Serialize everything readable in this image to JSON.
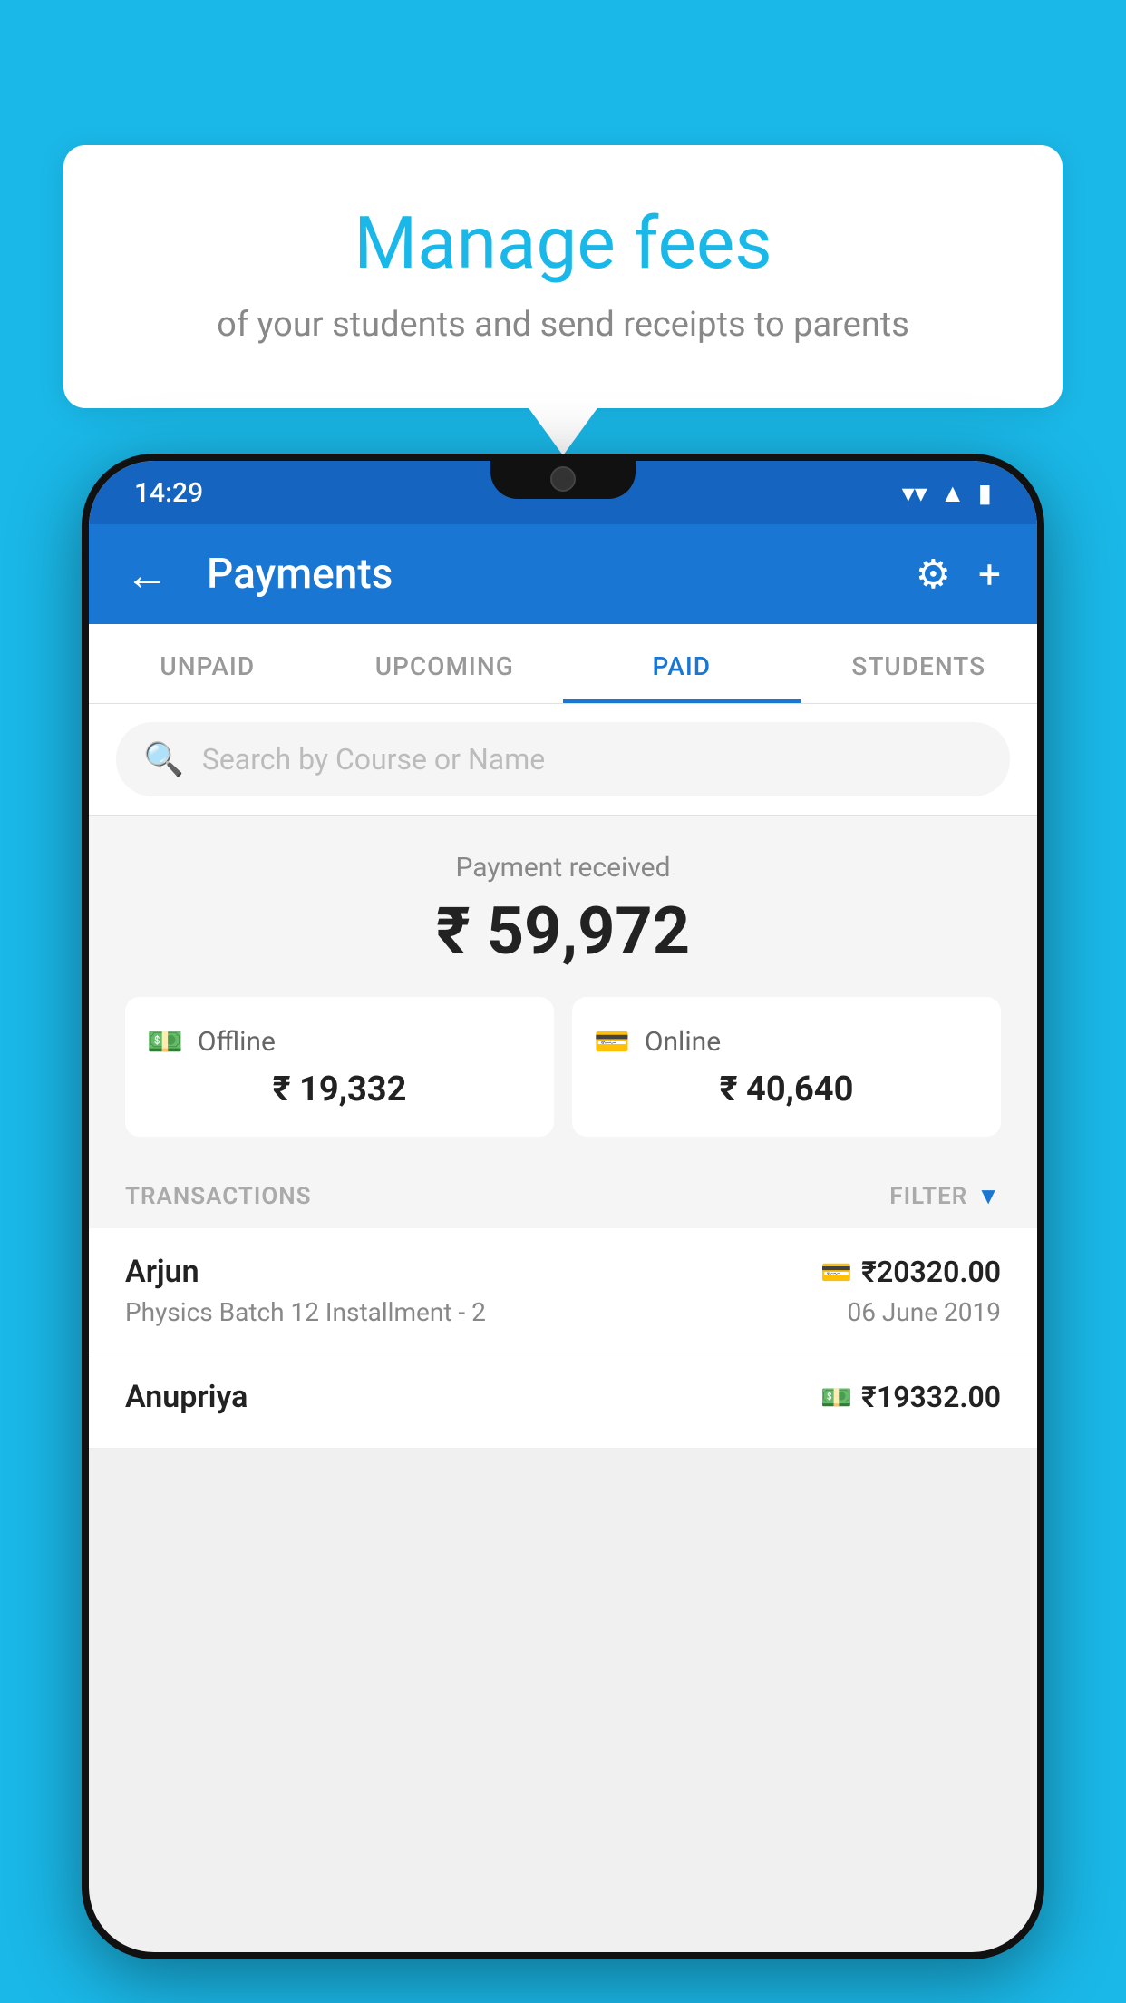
{
  "background_color": "#1ab8e8",
  "tooltip": {
    "title": "Manage fees",
    "subtitle": "of your students and send receipts to parents"
  },
  "phone": {
    "status_bar": {
      "time": "14:29"
    },
    "nav_bar": {
      "title": "Payments",
      "back_icon": "←",
      "settings_icon": "⚙",
      "add_icon": "+"
    },
    "tabs": [
      {
        "label": "UNPAID",
        "active": false
      },
      {
        "label": "UPCOMING",
        "active": false
      },
      {
        "label": "PAID",
        "active": true
      },
      {
        "label": "STUDENTS",
        "active": false
      }
    ],
    "search": {
      "placeholder": "Search by Course or Name"
    },
    "payment_summary": {
      "label": "Payment received",
      "amount": "₹ 59,972",
      "offline_label": "Offline",
      "offline_amount": "₹ 19,332",
      "online_label": "Online",
      "online_amount": "₹ 40,640"
    },
    "transactions_header": {
      "label": "TRANSACTIONS",
      "filter_label": "FILTER"
    },
    "transactions": [
      {
        "name": "Arjun",
        "course": "Physics Batch 12 Installment - 2",
        "amount": "₹20320.00",
        "date": "06 June 2019",
        "payment_type": "online"
      },
      {
        "name": "Anupriya",
        "course": "",
        "amount": "₹19332.00",
        "date": "",
        "payment_type": "offline"
      }
    ]
  }
}
